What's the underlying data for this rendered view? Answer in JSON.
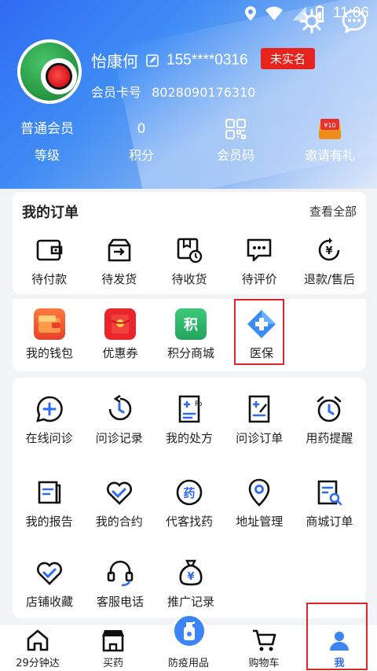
{
  "status_bar": {
    "time": "11:06"
  },
  "user": {
    "name": "怡康何",
    "phone": "155****0316",
    "verify_badge": "未实名",
    "card_label": "会员卡号",
    "card_no": "8028090176310"
  },
  "stats": [
    {
      "value": "普通会员",
      "label": "等级"
    },
    {
      "value": "0",
      "label": "积分"
    },
    {
      "icon": "qr-code-icon",
      "label": "会员码"
    },
    {
      "icon": "gift-voucher-icon",
      "label": "邀请有礼"
    }
  ],
  "orders": {
    "title": "我的订单",
    "view_all": "查看全部",
    "items": [
      {
        "label": "待付款",
        "icon": "wallet-pending-icon"
      },
      {
        "label": "待发货",
        "icon": "box-ship-icon"
      },
      {
        "label": "待收货",
        "icon": "package-clock-icon"
      },
      {
        "label": "待评价",
        "icon": "comment-icon"
      },
      {
        "label": "退款/售后",
        "icon": "refund-icon"
      }
    ]
  },
  "wallet": {
    "items": [
      {
        "label": "我的钱包",
        "icon": "wallet-icon",
        "color": "#f25a2c"
      },
      {
        "label": "优惠券",
        "icon": "coupon-icon",
        "color": "#e8262b"
      },
      {
        "label": "积分商城",
        "icon": "points-mall-icon",
        "color": "#2fb56a",
        "glyph": "积"
      },
      {
        "label": "医保",
        "icon": "medical-insurance-icon",
        "color": "#3b8cf2"
      }
    ]
  },
  "services": {
    "row1": [
      {
        "label": "在线问诊",
        "icon": "chat-plus-icon"
      },
      {
        "label": "问诊记录",
        "icon": "history-icon"
      },
      {
        "label": "我的处方",
        "icon": "prescription-icon"
      },
      {
        "label": "问诊订单",
        "icon": "order-edit-icon"
      },
      {
        "label": "用药提醒",
        "icon": "alarm-icon"
      }
    ],
    "row2": [
      {
        "label": "我的报告",
        "icon": "report-icon"
      },
      {
        "label": "我的合约",
        "icon": "handshake-icon"
      },
      {
        "label": "代客找药",
        "icon": "find-medicine-icon",
        "glyph": "药"
      },
      {
        "label": "地址管理",
        "icon": "location-icon"
      },
      {
        "label": "商城订单",
        "icon": "mall-order-icon"
      }
    ],
    "row3": [
      {
        "label": "店铺收藏",
        "icon": "heart-check-icon"
      },
      {
        "label": "客服电话",
        "icon": "headset-icon"
      },
      {
        "label": "推广记录",
        "icon": "money-bag-icon"
      }
    ]
  },
  "bottom_nav": [
    {
      "label": "29分钟达",
      "icon": "home-icon"
    },
    {
      "label": "买药",
      "icon": "store-icon"
    },
    {
      "label": "防疫用品",
      "icon": "sanitizer-icon"
    },
    {
      "label": "购物车",
      "icon": "cart-icon"
    },
    {
      "label": "我",
      "icon": "person-icon",
      "active": true
    }
  ],
  "colors": {
    "primary": "#2f6bf2",
    "badge_red": "#e8231d",
    "highlight": "#e0222b"
  }
}
